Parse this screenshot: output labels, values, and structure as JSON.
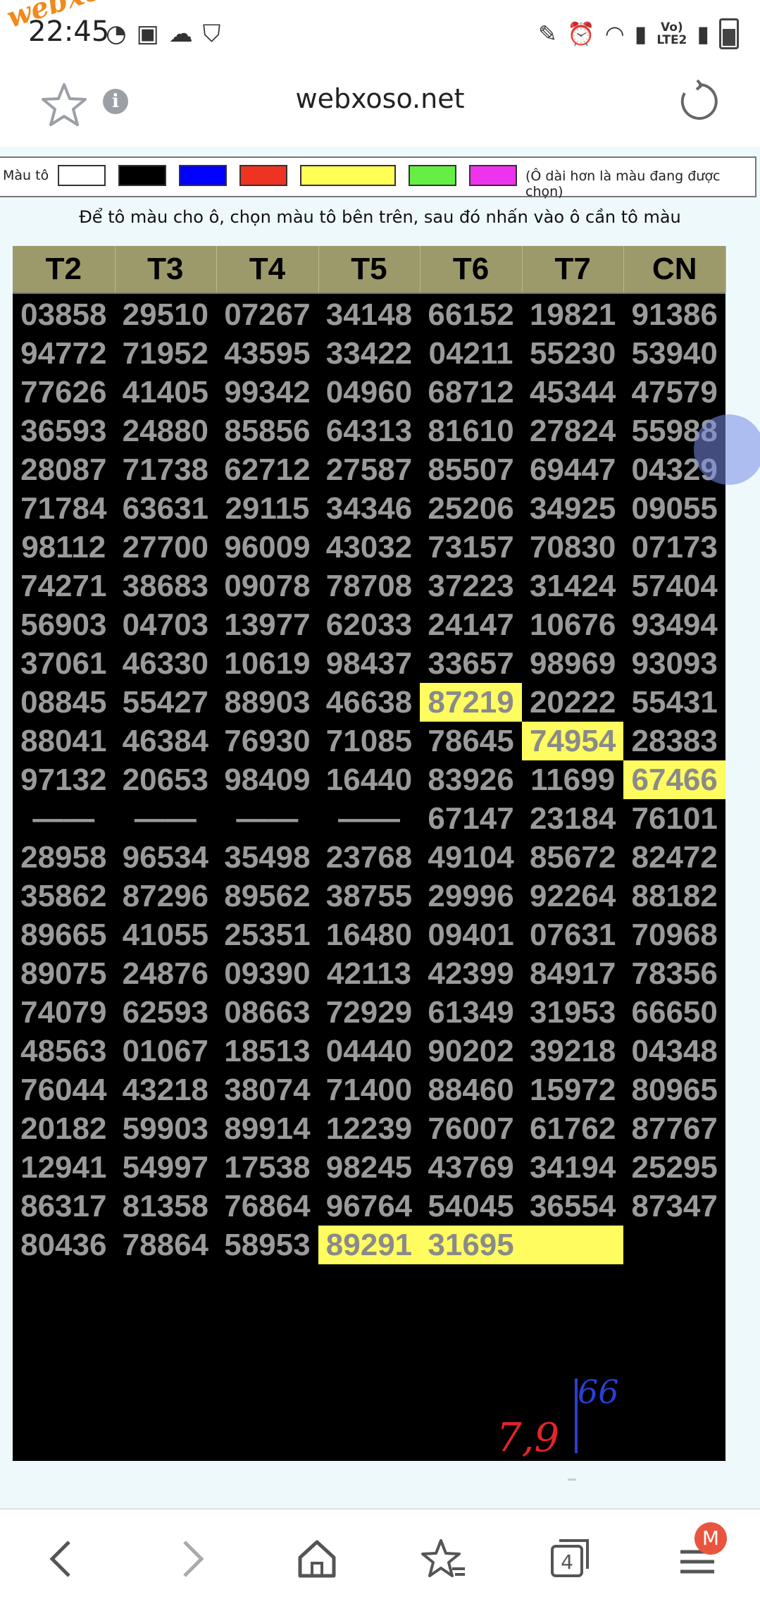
{
  "status_bar": {
    "time": "22:45",
    "watermark": "webxoso.net",
    "network_label_top": "Vo)",
    "network_label_bottom": "LTE2"
  },
  "browser": {
    "url": "webxoso.net"
  },
  "palette": {
    "label": "Màu tô",
    "swatches": [
      "#ffffff",
      "#000000",
      "#0000ff",
      "#ee3322",
      "#ffff55",
      "#66ee44",
      "#ee33ee"
    ],
    "selected_index": 4,
    "note": "(Ô dài hơn là màu đang được chọn)"
  },
  "instruction": "Để tô màu cho ô, chọn màu tô bên trên, sau đó nhấn vào ô cần tô màu",
  "table": {
    "headers": [
      "T2",
      "T3",
      "T4",
      "T5",
      "T6",
      "T7",
      "CN"
    ],
    "rows": [
      [
        "03858",
        "29510",
        "07267",
        "34148",
        "66152",
        "19821",
        "91386"
      ],
      [
        "94772",
        "71952",
        "43595",
        "33422",
        "04211",
        "55230",
        "53940"
      ],
      [
        "77626",
        "41405",
        "99342",
        "04960",
        "68712",
        "45344",
        "47579"
      ],
      [
        "36593",
        "24880",
        "85856",
        "64313",
        "81610",
        "27824",
        "55988"
      ],
      [
        "28087",
        "71738",
        "62712",
        "27587",
        "85507",
        "69447",
        "04329"
      ],
      [
        "71784",
        "63631",
        "29115",
        "34346",
        "25206",
        "34925",
        "09055"
      ],
      [
        "98112",
        "27700",
        "96009",
        "43032",
        "73157",
        "70830",
        "07173"
      ],
      [
        "74271",
        "38683",
        "09078",
        "78708",
        "37223",
        "31424",
        "57404"
      ],
      [
        "56903",
        "04703",
        "13977",
        "62033",
        "24147",
        "10676",
        "93494"
      ],
      [
        "37061",
        "46330",
        "10619",
        "98437",
        "33657",
        "98969",
        "93093"
      ],
      [
        "08845",
        "55427",
        "88903",
        "46638",
        "87219",
        "20222",
        "55431"
      ],
      [
        "88041",
        "46384",
        "76930",
        "71085",
        "78645",
        "74954",
        "28383"
      ],
      [
        "97132",
        "20653",
        "98409",
        "16440",
        "83926",
        "11699",
        "67466"
      ],
      [
        "——",
        "——",
        "——",
        "——",
        "67147",
        "23184",
        "76101"
      ],
      [
        "28958",
        "96534",
        "35498",
        "23768",
        "49104",
        "85672",
        "82472"
      ],
      [
        "35862",
        "87296",
        "89562",
        "38755",
        "29996",
        "92264",
        "88182"
      ],
      [
        "89665",
        "41055",
        "25351",
        "16480",
        "09401",
        "07631",
        "70968"
      ],
      [
        "89075",
        "24876",
        "09390",
        "42113",
        "42399",
        "84917",
        "78356"
      ],
      [
        "74079",
        "62593",
        "08663",
        "72929",
        "61349",
        "31953",
        "66650"
      ],
      [
        "48563",
        "01067",
        "18513",
        "04440",
        "90202",
        "39218",
        "04348"
      ],
      [
        "76044",
        "43218",
        "38074",
        "71400",
        "88460",
        "15972",
        "80965"
      ],
      [
        "20182",
        "59903",
        "89914",
        "12239",
        "76007",
        "61762",
        "87767"
      ],
      [
        "12941",
        "54997",
        "17538",
        "98245",
        "43769",
        "34194",
        "25295"
      ],
      [
        "86317",
        "81358",
        "76864",
        "96764",
        "54045",
        "36554",
        "87347"
      ],
      [
        "80436",
        "78864",
        "58953",
        "89291",
        "31695",
        "",
        ""
      ]
    ],
    "highlighted": [
      [
        10,
        4
      ],
      [
        11,
        5
      ],
      [
        12,
        6
      ],
      [
        24,
        3
      ],
      [
        24,
        4
      ],
      [
        24,
        5
      ]
    ]
  },
  "annotations": {
    "red_note": "7,9",
    "blue_note": "66"
  },
  "bottom_nav": {
    "tabs_count": "4",
    "avatar_letter": "M"
  },
  "colors": {
    "header_bg": "#9c9a6b",
    "board_bg": "#000000",
    "number_color": "#9a9a9a",
    "highlight": "#fffc60"
  }
}
